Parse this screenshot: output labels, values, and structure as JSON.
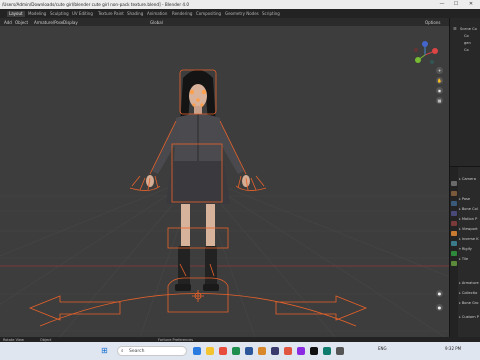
{
  "window": {
    "title": "/Users/Admin/Downloads/cute girl/blender cute girl non-pack texture.blend] - Blender 4.0",
    "controls": {
      "minimize": "—",
      "maximize": "☐",
      "close": "✕"
    }
  },
  "workspaces": {
    "tabs": [
      "Layout",
      "Modeling",
      "Sculpting",
      "UV Editing",
      "Texture Paint",
      "Shading",
      "Animation",
      "Rendering",
      "Compositing",
      "Geometry Nodes",
      "Scripting"
    ],
    "active": "Layout",
    "scene_label": "Scene"
  },
  "viewport_header": {
    "items": [
      "Add",
      "Object",
      "Armature/Pose",
      "Display"
    ],
    "transform": "Global",
    "options": "Options"
  },
  "outliner": {
    "rows": [
      "Scene Co",
      "Co",
      "gen",
      "Co"
    ]
  },
  "properties": {
    "rows": [
      "Camera",
      "Pose",
      "Bone Col",
      "Motion P",
      "Viewport",
      "Inverse K",
      "Rigify",
      "Tile",
      "Armature",
      "Collectio",
      "Bone Gro",
      "Custom P"
    ]
  },
  "footer": {
    "left": "Rotate View",
    "middle": "Object",
    "center": "Fortune Preferences"
  },
  "taskbar": {
    "search_placeholder": "Search",
    "tray_lang": "ENG",
    "tray_time": "9:32 PM"
  },
  "colors": {
    "viewport_bg": "#3d3d3d",
    "rig_orange": "#e8622a",
    "selection_orange": "#ffa04c",
    "grid_line": "#474747",
    "axis_red": "#8a3a3a",
    "axis_green": "#5a7a2a",
    "taskbar_bg": "#dfe6ef"
  }
}
